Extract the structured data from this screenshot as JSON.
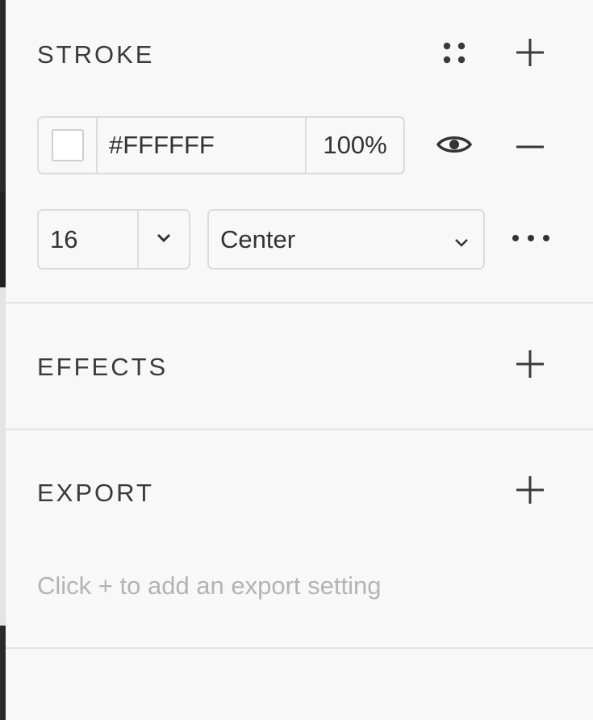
{
  "stroke": {
    "title": "STROKE",
    "color_hex": "#FFFFFF",
    "opacity": "100%",
    "swatch_color": "#FFFFFF",
    "weight": "16",
    "position": "Center",
    "icons": {
      "style": "dots-grid-icon",
      "add": "plus-icon",
      "visibility": "eye-icon",
      "remove": "minus-icon",
      "more": "more-horizontal-icon",
      "weight_dropdown": "chevron-down-icon",
      "position_dropdown": "chevron-down-icon"
    }
  },
  "effects": {
    "title": "EFFECTS",
    "add_icon": "plus-icon"
  },
  "export": {
    "title": "EXPORT",
    "add_icon": "plus-icon",
    "hint": "Click + to add an export setting"
  }
}
